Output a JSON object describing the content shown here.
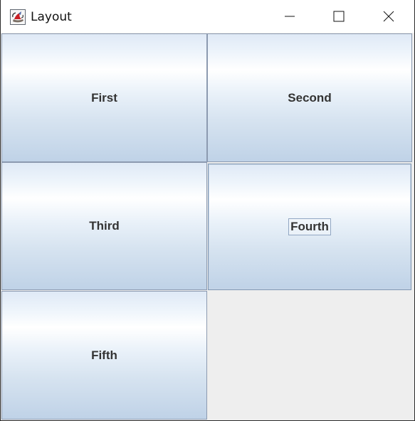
{
  "window": {
    "title": "Layout",
    "icon_name": "java-cup-icon"
  },
  "title_controls": {
    "minimize": "minimize-icon",
    "maximize": "maximize-icon",
    "close": "close-icon"
  },
  "buttons": [
    {
      "label": "First"
    },
    {
      "label": "Second"
    },
    {
      "label": "Third"
    },
    {
      "label": "Fourth",
      "focused": true
    },
    {
      "label": "Fifth"
    }
  ],
  "colors": {
    "titlebar": "#ffffff",
    "content_background": "#eeeeee",
    "button_text": "#333333",
    "button_border": "#8c9ab0",
    "gradient_top": "#dfe9f6",
    "gradient_light": "#ffffff",
    "gradient_bottom": "#bfd2e7"
  }
}
